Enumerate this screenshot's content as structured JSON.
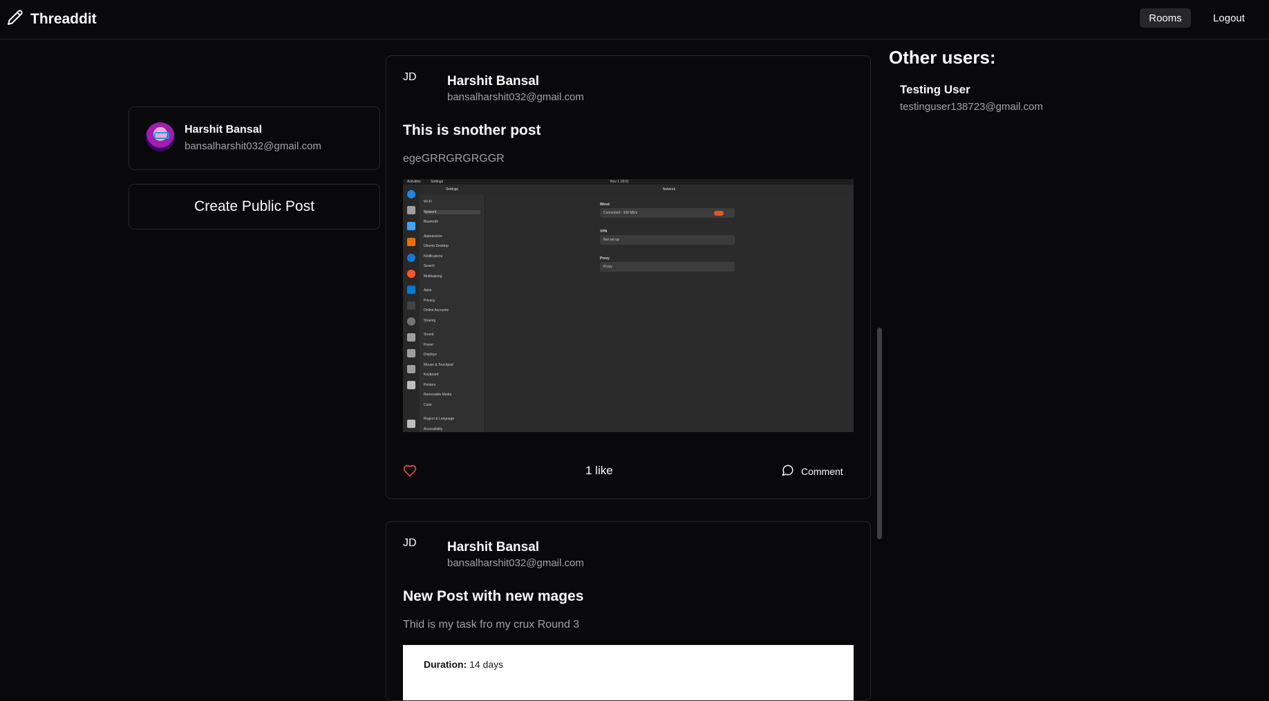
{
  "header": {
    "brand": "Threaddit",
    "nav": {
      "rooms": "Rooms",
      "logout": "Logout"
    }
  },
  "profile": {
    "name": "Harshit Bansal",
    "email": "bansalharshit032@gmail.com"
  },
  "create_post_label": "Create Public Post",
  "posts": [
    {
      "initials": "JD",
      "author": "Harshit Bansal",
      "email": "bansalharshit032@gmail.com",
      "title": "This is snother post",
      "body": "egeGRRGRGRGGR",
      "likes_text": "1 like",
      "comment_label": "Comment",
      "liked": true,
      "image": {
        "topbar": {
          "left": "Activities",
          "app": "Settings",
          "center": "Nov 1  18:01"
        },
        "sidebar_title": "Settings",
        "main_title": "Network",
        "sidebar_items": [
          "Wi-Fi",
          "Network",
          "Bluetooth",
          "Appearance",
          "Ubuntu Desktop",
          "Notifications",
          "Search",
          "Multitasking",
          "Apps",
          "Privacy",
          "Online Accounts",
          "Sharing",
          "Sound",
          "Power",
          "Displays",
          "Mouse & Touchpad",
          "Keyboard",
          "Printers",
          "Removable Media",
          "Color",
          "Region & Language",
          "Accessibility"
        ],
        "groups": [
          {
            "label": "Wired",
            "row": "Connected - 100 Mb/s"
          },
          {
            "label": "VPN",
            "row": "Not set up"
          },
          {
            "label": "Proxy",
            "row": "Proxy"
          }
        ]
      }
    },
    {
      "initials": "JD",
      "author": "Harshit Bansal",
      "email": "bansalharshit032@gmail.com",
      "title": "New Post with new mages",
      "body": "Thid is my task fro my crux Round 3",
      "image": {
        "label": "Duration:",
        "value": "14 days"
      }
    }
  ],
  "other_users": {
    "title": "Other users:",
    "users": [
      {
        "name": "Testing User",
        "email": "testinguser138723@gmail.com"
      }
    ]
  },
  "colors": {
    "background": "#09090b",
    "border": "#27272a",
    "muted": "#a1a1aa",
    "like": "#ef4444"
  }
}
